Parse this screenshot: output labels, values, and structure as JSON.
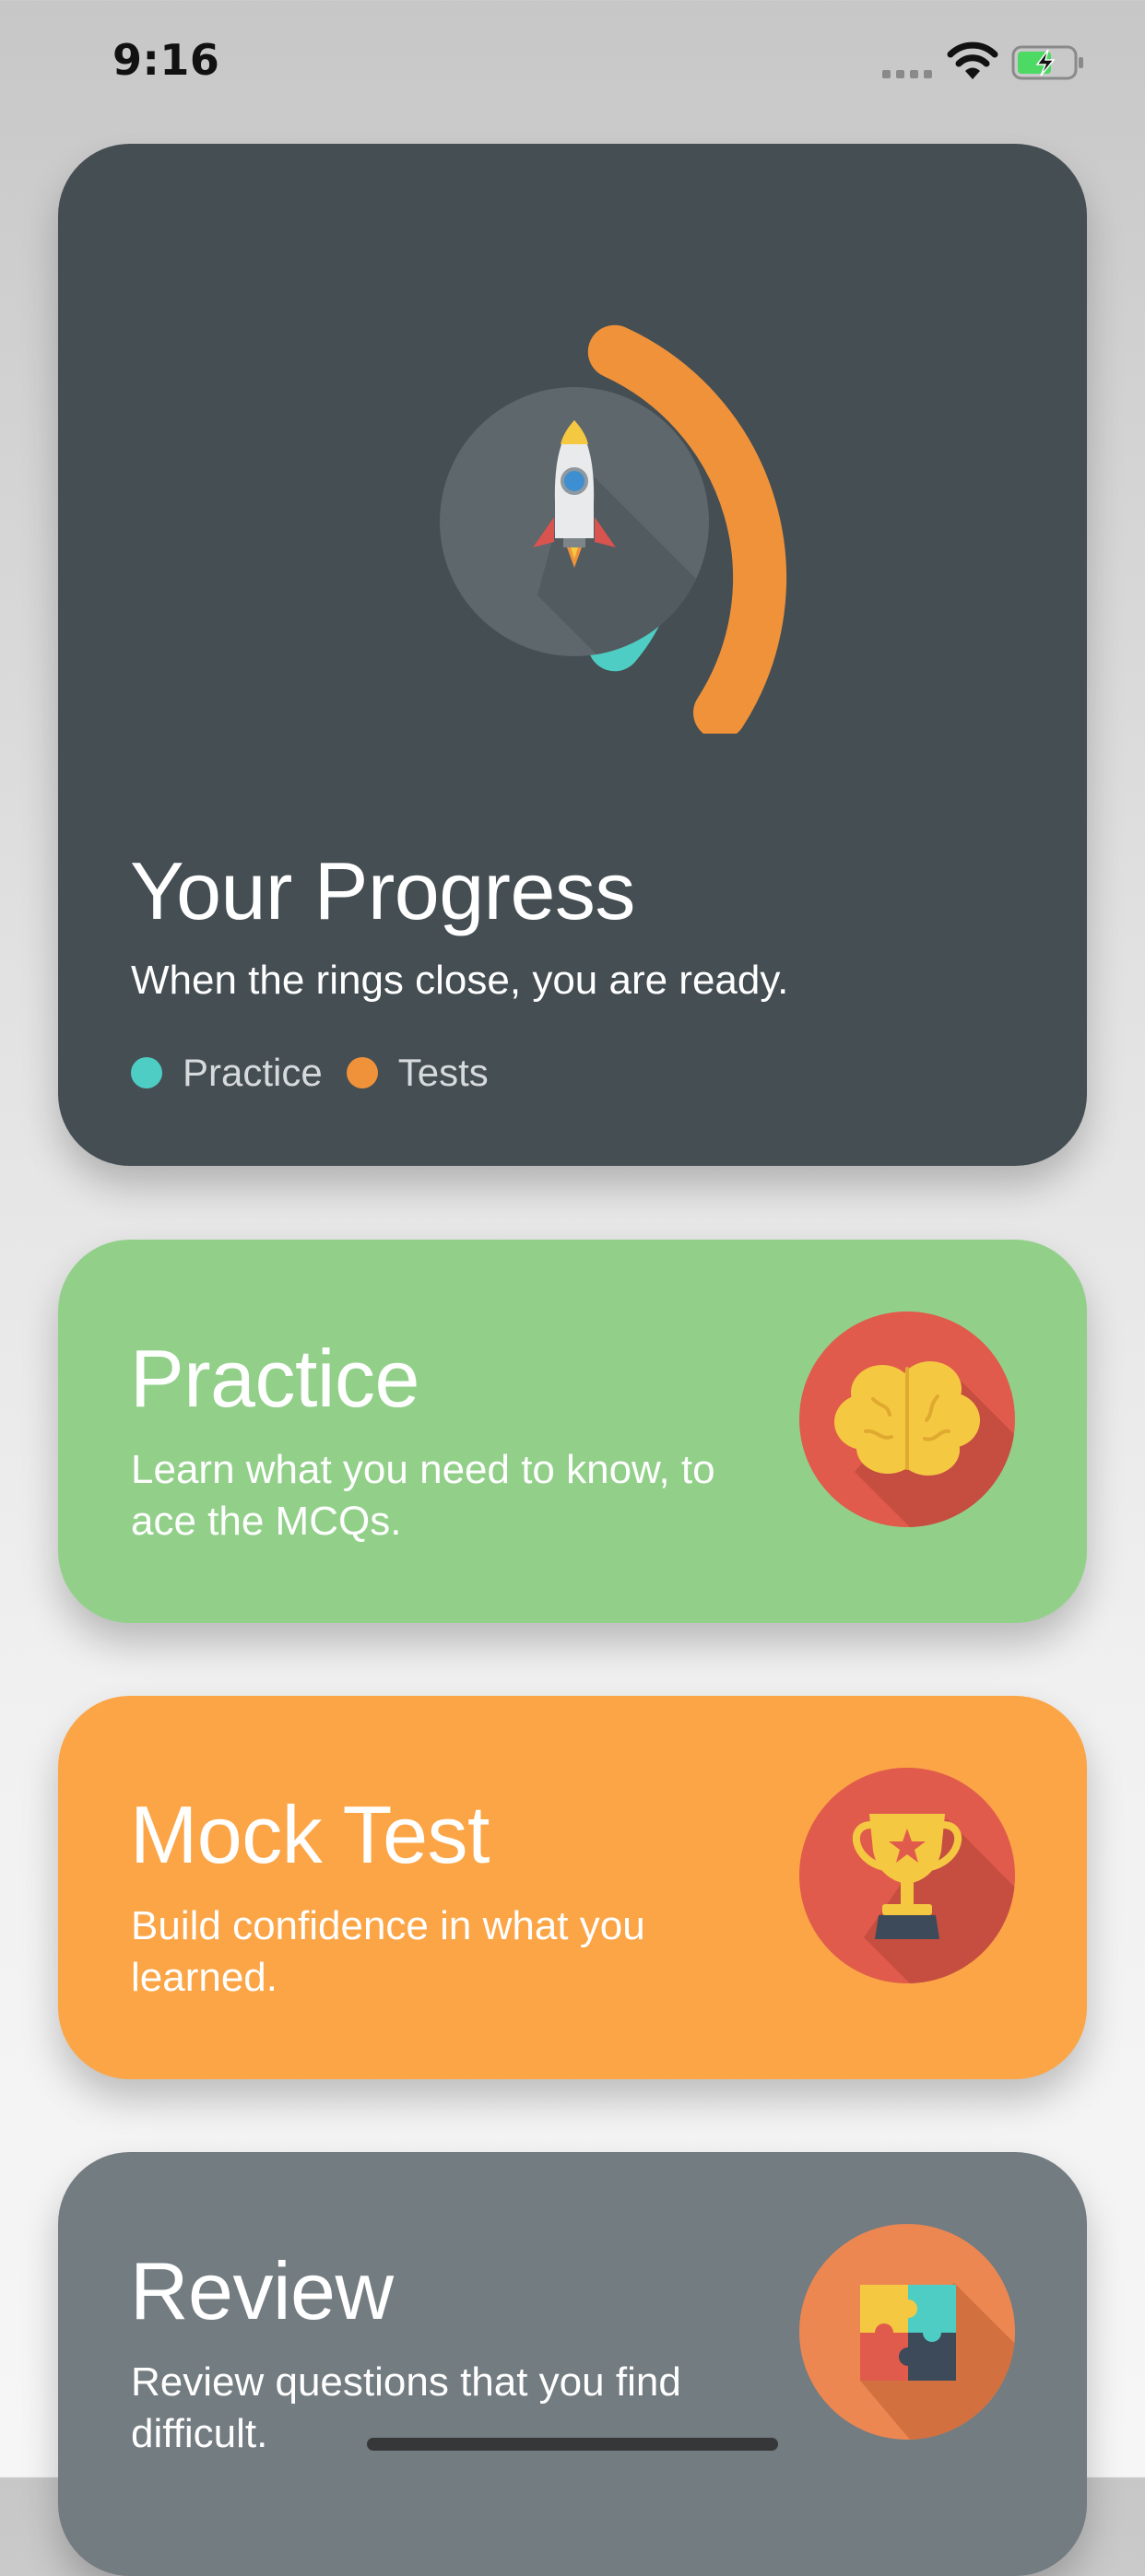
{
  "status_bar": {
    "time": "9:16",
    "icons": [
      "signal-icon",
      "wifi-icon",
      "battery-charging-icon"
    ]
  },
  "progress_card": {
    "title": "Your Progress",
    "subtitle": "When the rings close, you are ready.",
    "legend": [
      {
        "label": "Practice",
        "color": "#4ecdc4"
      },
      {
        "label": "Tests",
        "color": "#f0923a"
      }
    ],
    "icon": "rocket-icon"
  },
  "practice_card": {
    "title": "Practice",
    "subtitle": "Learn what you need to know, to ace the MCQs.",
    "icon": "brain-icon",
    "color": "#92d08a"
  },
  "mock_test_card": {
    "title": "Mock Test",
    "subtitle": "Build confidence in what you learned.",
    "icon": "trophy-icon",
    "color": "#fba546"
  },
  "review_card": {
    "title": "Review",
    "subtitle": "Review questions that you find difficult.",
    "icon": "puzzle-icon",
    "color": "#737c81"
  },
  "colors": {
    "progress_card_bg": "#444e53",
    "practice_ring": "#4ecdc4",
    "tests_ring": "#f0923a"
  }
}
